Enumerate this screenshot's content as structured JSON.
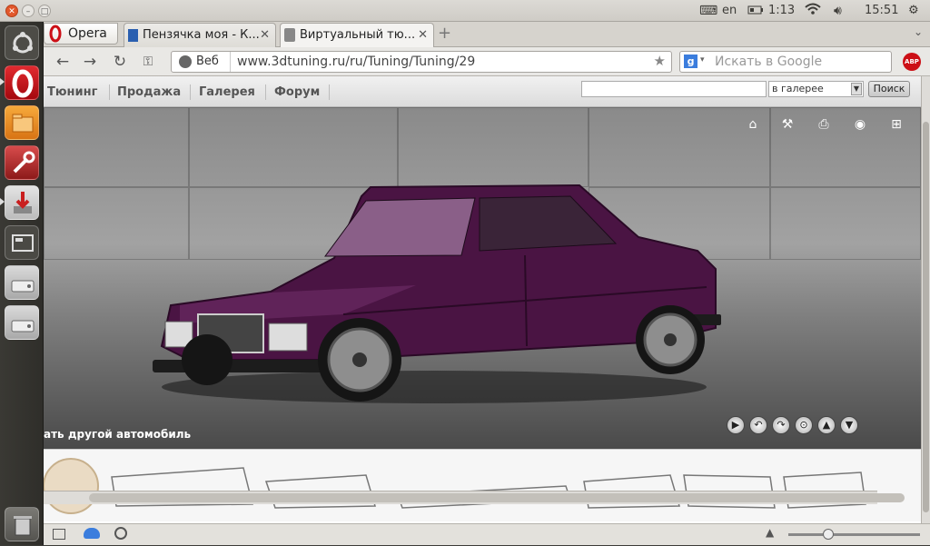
{
  "top_panel": {
    "keyboard_layout": "en",
    "battery_time": "1:13",
    "clock": "15:51"
  },
  "browser": {
    "menu_label": "Opera",
    "tabs": [
      {
        "title": "Пензячка моя - К..."
      },
      {
        "title": "Виртуальный тю..."
      }
    ],
    "address": {
      "badge": "Веб",
      "url": "www.3dtuning.ru/ru/Tuning/Tuning/29"
    },
    "search": {
      "placeholder": "Искать в Google"
    },
    "adblock_label": "ABP"
  },
  "site": {
    "nav": [
      "Тюнинг",
      "Продажа",
      "Галерея",
      "Форум"
    ],
    "search_scope": "в галерее",
    "search_button": "Поиск",
    "select_car_link": "ать другой автомобиль"
  },
  "colors": {
    "car_body": "#4a1443",
    "close_button": "#e2582c",
    "opera_red": "#cc0f16"
  },
  "icons": {
    "toolbar": [
      "home-icon",
      "wrench-icon",
      "printer-icon",
      "camera-icon",
      "sitemap-icon"
    ],
    "controls": [
      "play-icon",
      "rotate-left-icon",
      "rotate-right-icon",
      "reset-icon",
      "upload-icon",
      "download-icon"
    ]
  },
  "zoom_slider_level": 0.3
}
